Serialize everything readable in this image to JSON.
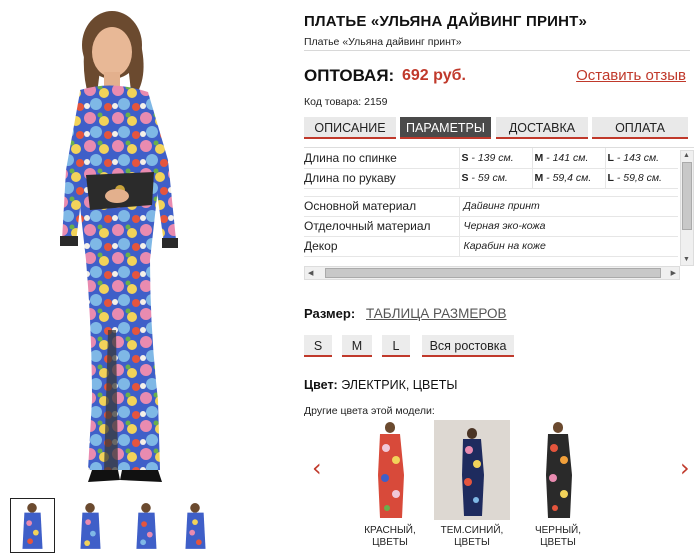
{
  "product": {
    "title": "ПЛАТЬЕ «УЛЬЯНА ДАЙВИНГ ПРИНТ»",
    "subtitle": "Платье «Ульяна дайвинг принт»",
    "price_label": "ОПТОВАЯ:",
    "price_value": "692 руб.",
    "review_link": "Оставить отзыв",
    "sku": "Код товара: 2159"
  },
  "tabs": [
    {
      "label": "ОПИСАНИЕ",
      "active": false
    },
    {
      "label": "ПАРАМЕТРЫ",
      "active": true
    },
    {
      "label": "ДОСТАВКА",
      "active": false
    },
    {
      "label": "ОПЛАТА",
      "active": false
    }
  ],
  "params": {
    "measurements": [
      {
        "name": "Длина по спинке",
        "s_key": "S",
        "s_val": " - 139 см.",
        "m_key": "M",
        "m_val": " - 141 см.",
        "l_key": "L",
        "l_val": " - 143 см."
      },
      {
        "name": "Длина по рукаву",
        "s_key": "S",
        "s_val": " - 59 см.",
        "m_key": "M",
        "m_val": " - 59,4 см.",
        "l_key": "L",
        "l_val": " - 59,8 см."
      }
    ],
    "materials": [
      {
        "name": "Основной материал",
        "value": "Дайвинг принт"
      },
      {
        "name": "Отделочный материал",
        "value": "Черная эко-кожа"
      },
      {
        "name": "Декор",
        "value": "Карабин на коже"
      }
    ]
  },
  "size": {
    "label": "Размер:",
    "table_link": "ТАБЛИЦА РАЗМЕРОВ",
    "options": [
      "S",
      "M",
      "L",
      "Вся ростовка"
    ]
  },
  "color": {
    "label": "Цвет:",
    "value": "ЭЛЕКТРИК, ЦВЕТЫ",
    "other_label": "Другие цвета этой модели:"
  },
  "variants": [
    {
      "line1": "КРАСНЫЙ,",
      "line2": "ЦВЕТЫ"
    },
    {
      "line1": "ТЕМ.СИНИЙ,",
      "line2": "ЦВЕТЫ"
    },
    {
      "line1": "ЧЕРНЫЙ,",
      "line2": "ЦВЕТЫ"
    }
  ],
  "carousel_arrows": {
    "left": "‹",
    "right": "›"
  },
  "icons": {
    "scroll_up": "▲",
    "scroll_down": "▼",
    "scroll_left": "◀",
    "scroll_right": "▶"
  },
  "colors": {
    "accent": "#c0392b",
    "active_tab": "#4a4a4a",
    "tab_bg": "#e9e9e9"
  }
}
